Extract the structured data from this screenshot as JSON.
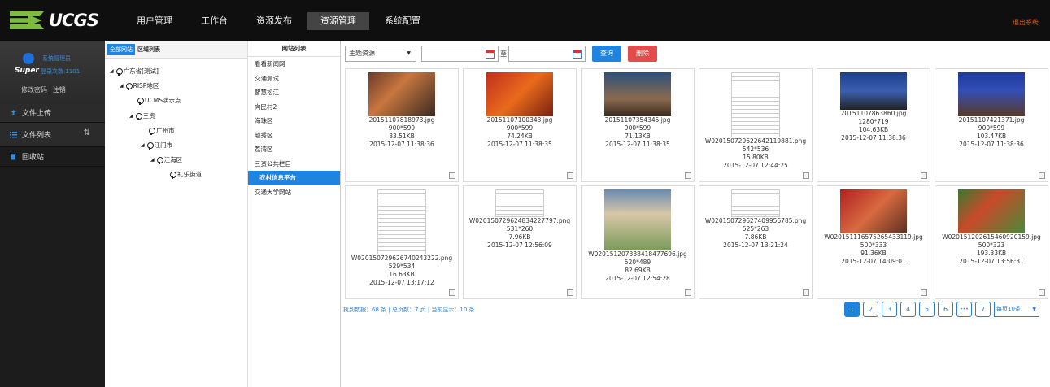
{
  "brand": {
    "name": "UCGS"
  },
  "nav": {
    "items": [
      {
        "label": "用户管理"
      },
      {
        "label": "工作台"
      },
      {
        "label": "资源发布"
      },
      {
        "label": "资源管理",
        "active": true
      },
      {
        "label": "系统配置"
      }
    ],
    "logout": "退出系统"
  },
  "user": {
    "role": "系统管理员",
    "name": "Super",
    "login_count": "登录次数:1101",
    "change_password": "修改密码",
    "separator": "|",
    "sign_out": "注销"
  },
  "sidebar": {
    "items": [
      {
        "label": "文件上传",
        "icon": "upload-icon"
      },
      {
        "label": "文件列表",
        "icon": "list-icon"
      },
      {
        "label": "回收站",
        "icon": "trash-icon"
      }
    ]
  },
  "region": {
    "tabs": [
      {
        "label": "全部网站"
      },
      {
        "label": "区域列表"
      }
    ],
    "tree": [
      {
        "label": "广东省[测试]"
      },
      {
        "label": "RISP地区"
      },
      {
        "label": "UCMS演示点"
      },
      {
        "label": "三资"
      },
      {
        "label": "广州市"
      },
      {
        "label": "江门市"
      },
      {
        "label": "江海区"
      },
      {
        "label": "礼乐街道"
      }
    ]
  },
  "sites": {
    "header": "网站列表",
    "items": [
      {
        "label": "看看新闻网"
      },
      {
        "label": "交通测试"
      },
      {
        "label": "智慧松江"
      },
      {
        "label": "向民村2"
      },
      {
        "label": "海珠区"
      },
      {
        "label": "越秀区"
      },
      {
        "label": "荔湾区"
      },
      {
        "label": "三资公共栏目"
      },
      {
        "label": "农村信息平台"
      },
      {
        "label": "交通大学网站"
      }
    ]
  },
  "toolbar": {
    "select_value": "主题资源",
    "date_start": "",
    "date_end": "",
    "to_label": "至",
    "query": "查询",
    "delete": "删除"
  },
  "files": [
    {
      "name": "20151107818973.jpg",
      "dims": "900*599",
      "size": "83.51KB",
      "date": "2015-12-07 11:38:36",
      "kind": "photo"
    },
    {
      "name": "20151107100343.jpg",
      "dims": "900*599",
      "size": "74.24KB",
      "date": "2015-12-07 11:38:35",
      "kind": "photo"
    },
    {
      "name": "20151107354345.jpg",
      "dims": "900*599",
      "size": "71.13KB",
      "date": "2015-12-07 11:38:35",
      "kind": "photo"
    },
    {
      "name": "W020150729622642119881.png",
      "dims": "542*536",
      "size": "15.80KB",
      "date": "2015-12-07 12:44:25",
      "kind": "table"
    },
    {
      "name": "20151107863860.jpg",
      "dims": "1280*719",
      "size": "104.63KB",
      "date": "2015-12-07 11:38:36",
      "kind": "photo"
    },
    {
      "name": "20151107421371.jpg",
      "dims": "900*599",
      "size": "103.47KB",
      "date": "2015-12-07 11:38:36",
      "kind": "photo"
    },
    {
      "name": "W020150729626740243222.png",
      "dims": "529*534",
      "size": "16.63KB",
      "date": "2015-12-07 13:17:12",
      "kind": "table"
    },
    {
      "name": "W020150729624834227797.png",
      "dims": "531*260",
      "size": "7.96KB",
      "date": "2015-12-07 12:56:09",
      "kind": "table"
    },
    {
      "name": "W020151207338418477696.jpg",
      "dims": "520*489",
      "size": "82.69KB",
      "date": "2015-12-07 12:54:28",
      "kind": "photo"
    },
    {
      "name": "W020150729627409956785.png",
      "dims": "525*263",
      "size": "7.86KB",
      "date": "2015-12-07 13:21:24",
      "kind": "table"
    },
    {
      "name": "W020151116575265433119.jpg",
      "dims": "500*333",
      "size": "91.36KB",
      "date": "2015-12-07 14:09:01",
      "kind": "photo"
    },
    {
      "name": "W020151202615460920159.jpg",
      "dims": "500*323",
      "size": "193.33KB",
      "date": "2015-12-07 13:56:31",
      "kind": "photo"
    }
  ],
  "summary": "找到数据：68 条 | 总页数：7 页 | 当前显示：10 条",
  "pagination": {
    "pages": [
      "1",
      "2",
      "3",
      "4",
      "5",
      "6",
      "•••",
      "7"
    ],
    "current": "1",
    "per_page": "每页10条"
  },
  "colors": {
    "accent": "#1e84e0",
    "danger": "#e34c4c",
    "brand_green": "#7dbb3c",
    "topbar": "#0f0f0f"
  }
}
